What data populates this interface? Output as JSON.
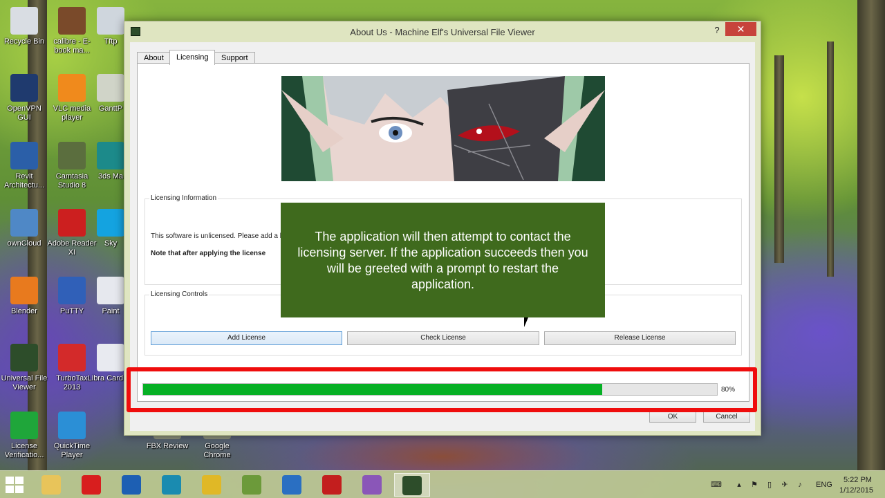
{
  "window": {
    "title": "About Us - Machine Elf's Universal File Viewer",
    "help_label": "?",
    "close_label": "✕"
  },
  "tabs": [
    {
      "label": "About"
    },
    {
      "label": "Licensing"
    },
    {
      "label": "Support"
    }
  ],
  "licensing_info": {
    "label": "Licensing Information",
    "line1": "This software is unlicensed. Please add a li",
    "line2": "Note that after applying the license"
  },
  "licensing_controls": {
    "label": "Licensing Controls",
    "add_label": "Add License",
    "check_label": "Check License",
    "release_label": "Release License"
  },
  "overlay": {
    "text": "The application will then attempt to contact the licensing server. If the application succeeds then you will be greeted with a prompt to restart the application."
  },
  "progress": {
    "value": 0.8,
    "label": "80%"
  },
  "footer": {
    "ok_label": "OK",
    "cancel_label": "Cancel"
  },
  "desktop_icons": [
    {
      "label": "Recycle Bin",
      "icon": "recycle-bin-icon",
      "color": "#d9dde3"
    },
    {
      "label": "calibre - E-book ma...",
      "icon": "calibre-icon",
      "color": "#7a4a2a"
    },
    {
      "label": "Tftp",
      "icon": "tftp-icon",
      "color": "#cfd6dd"
    },
    {
      "label": "OpenVPN GUI",
      "icon": "openvpn-icon",
      "color": "#1f3a6e"
    },
    {
      "label": "VLC media player",
      "icon": "vlc-icon",
      "color": "#f08a1c"
    },
    {
      "label": "GanttP",
      "icon": "gantt-icon",
      "color": "#d0d4c8"
    },
    {
      "label": "Revit Architectu...",
      "icon": "revit-icon",
      "color": "#2b5fa8"
    },
    {
      "label": "Camtasia Studio 8",
      "icon": "camtasia-icon",
      "color": "#5b6e3e"
    },
    {
      "label": "3ds Ma",
      "icon": "3dsmax-icon",
      "color": "#1c8a8a"
    },
    {
      "label": "ownCloud",
      "icon": "owncloud-icon",
      "color": "#4f88c6"
    },
    {
      "label": "Adobe Reader XI",
      "icon": "adobe-reader-icon",
      "color": "#cc1f1f"
    },
    {
      "label": "Sky",
      "icon": "skype-icon",
      "color": "#14a3e0"
    },
    {
      "label": "Blender",
      "icon": "blender-icon",
      "color": "#e87a1e"
    },
    {
      "label": "PuTTY",
      "icon": "putty-icon",
      "color": "#3060b8"
    },
    {
      "label": "Paint",
      "icon": "paint-icon",
      "color": "#e6e8ee"
    },
    {
      "label": "Universal File Viewer",
      "icon": "universal-file-viewer-icon",
      "color": "#2d4d2a"
    },
    {
      "label": "TurboTax 2013",
      "icon": "turbotax-icon",
      "color": "#d32a2a"
    },
    {
      "label": "Libra Card Lo",
      "icon": "library-card-icon",
      "color": "#e8eaf0"
    },
    {
      "label": "License Verificatio...",
      "icon": "license-verification-icon",
      "color": "#1fa63a"
    },
    {
      "label": "QuickTime Player",
      "icon": "quicktime-icon",
      "color": "#2b8fd6"
    },
    {
      "label": "FBX Review",
      "icon": "fbx-review-icon",
      "color": "#8a8f7a"
    },
    {
      "label": "Google Chrome",
      "icon": "google-chrome-icon",
      "color": "#8a8f7a"
    }
  ],
  "taskbar": {
    "items": [
      {
        "icon": "file-explorer-icon",
        "color": "#e8c45a"
      },
      {
        "icon": "opera-icon",
        "color": "#d81e1e"
      },
      {
        "icon": "outlook-icon",
        "color": "#1d5fb3"
      },
      {
        "icon": "network-icon",
        "color": "#1a8bb0"
      },
      {
        "icon": "chrome-icon",
        "color": "#e0b826"
      },
      {
        "icon": "app-icon",
        "color": "#6c9a3a"
      },
      {
        "icon": "firefox-icon",
        "color": "#2a6fc2"
      },
      {
        "icon": "filezilla-icon",
        "color": "#c31e1e"
      },
      {
        "icon": "phpstorm-icon",
        "color": "#8a56b8"
      },
      {
        "icon": "universal-file-viewer-icon",
        "color": "#2d4d2a"
      }
    ],
    "language": "ENG",
    "time": "5:22 PM",
    "date": "1/12/2015"
  }
}
